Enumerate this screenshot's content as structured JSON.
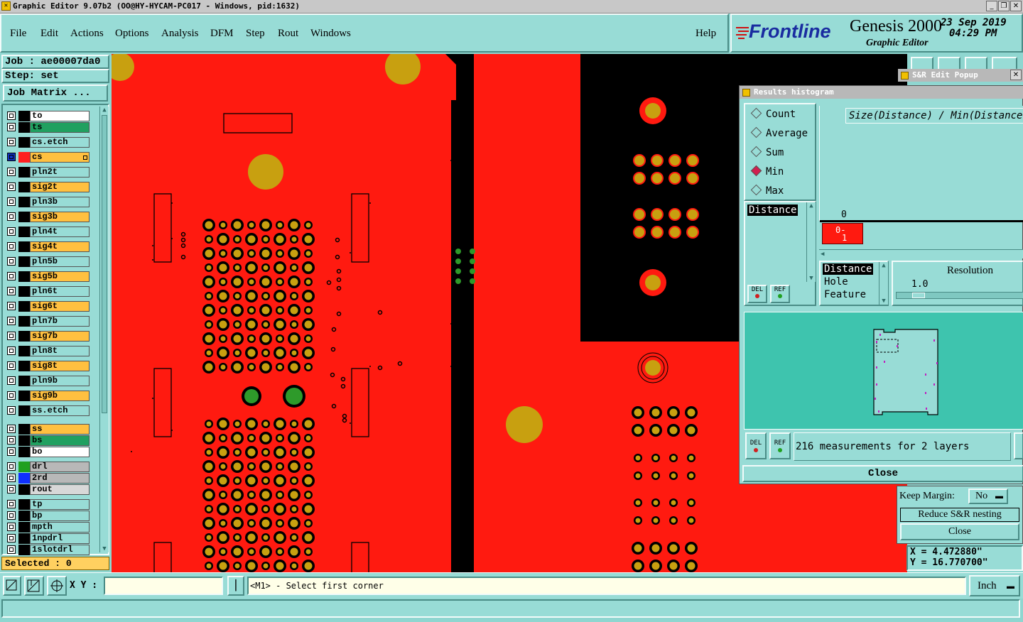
{
  "window": {
    "title": "Graphic Editor 9.07b2  (OO@HY-HYCAM-PC017 - Windows, pid:1632)"
  },
  "menu": {
    "items": [
      "File",
      "Edit",
      "Actions",
      "Options",
      "Analysis",
      "DFM",
      "Step",
      "Rout",
      "Windows"
    ],
    "help": "Help"
  },
  "branding": {
    "logo": "Frontline",
    "product": "Genesis 2000",
    "subtitle": "Graphic Editor",
    "date": "23 Sep 2019",
    "time": "04:29 PM"
  },
  "left": {
    "job": "Job : ae00007da0",
    "step": "Step: set",
    "job_matrix": "Job Matrix ...",
    "selected": "Selected : 0"
  },
  "layers": [
    {
      "name": "to",
      "color": "#ffffff",
      "swatch": "#000000",
      "group": 0
    },
    {
      "name": "ts",
      "color": "#20a060",
      "swatch": "#000000",
      "group": 0
    },
    {
      "name": "cs.etch",
      "color": "#98dcd6",
      "swatch": "#000000",
      "group": 1
    },
    {
      "name": "cs",
      "color": "#ffc040",
      "swatch": "#ff2020",
      "group": 1,
      "active": true
    },
    {
      "name": "pln2t",
      "color": "#98dcd6",
      "swatch": "#000000",
      "group": 1
    },
    {
      "name": "sig2t",
      "color": "#ffc040",
      "swatch": "#000000",
      "group": 1
    },
    {
      "name": "pln3b",
      "color": "#98dcd6",
      "swatch": "#000000",
      "group": 1
    },
    {
      "name": "sig3b",
      "color": "#ffc040",
      "swatch": "#000000",
      "group": 1
    },
    {
      "name": "pln4t",
      "color": "#98dcd6",
      "swatch": "#000000",
      "group": 1
    },
    {
      "name": "sig4t",
      "color": "#ffc040",
      "swatch": "#000000",
      "group": 1
    },
    {
      "name": "pln5b",
      "color": "#98dcd6",
      "swatch": "#000000",
      "group": 1
    },
    {
      "name": "sig5b",
      "color": "#ffc040",
      "swatch": "#000000",
      "group": 1
    },
    {
      "name": "pln6t",
      "color": "#98dcd6",
      "swatch": "#000000",
      "group": 1
    },
    {
      "name": "sig6t",
      "color": "#ffc040",
      "swatch": "#000000",
      "group": 1
    },
    {
      "name": "pln7b",
      "color": "#98dcd6",
      "swatch": "#000000",
      "group": 1
    },
    {
      "name": "sig7b",
      "color": "#ffc040",
      "swatch": "#000000",
      "group": 1
    },
    {
      "name": "pln8t",
      "color": "#98dcd6",
      "swatch": "#000000",
      "group": 1
    },
    {
      "name": "sig8t",
      "color": "#ffc040",
      "swatch": "#000000",
      "group": 1
    },
    {
      "name": "pln9b",
      "color": "#98dcd6",
      "swatch": "#000000",
      "group": 1
    },
    {
      "name": "sig9b",
      "color": "#ffc040",
      "swatch": "#000000",
      "group": 1
    },
    {
      "name": "ss.etch",
      "color": "#98dcd6",
      "swatch": "#000000",
      "group": 1
    },
    {
      "name": "ss",
      "color": "#ffc040",
      "swatch": "#000000",
      "group": 2
    },
    {
      "name": "bs",
      "color": "#20a060",
      "swatch": "#000000",
      "group": 2
    },
    {
      "name": "bo",
      "color": "#ffffff",
      "swatch": "#000000",
      "group": 2
    },
    {
      "name": "drl",
      "color": "#b8b8b8",
      "swatch": "#20a020",
      "group": 3
    },
    {
      "name": "2rd",
      "color": "#b8b8b8",
      "swatch": "#1030ff",
      "group": 3
    },
    {
      "name": "rout",
      "color": "#d8d8d8",
      "swatch": "#000000",
      "group": 3
    },
    {
      "name": "tp",
      "color": "#98dcd6",
      "swatch": "#000000",
      "group": 4
    },
    {
      "name": "bp",
      "color": "#98dcd6",
      "swatch": "#000000",
      "group": 4
    },
    {
      "name": "mpth",
      "color": "#98dcd6",
      "swatch": "#000000",
      "group": 4
    },
    {
      "name": "1npdrl",
      "color": "#98dcd6",
      "swatch": "#000000",
      "group": 4
    },
    {
      "name": "1slotdrl",
      "color": "#98dcd6",
      "swatch": "#000000",
      "group": 4
    }
  ],
  "sr_popup": {
    "title": "S&R Edit Popup",
    "keep_margin_label": "Keep Margin:",
    "keep_margin_value": "No",
    "reduce": "Reduce S&R nesting",
    "close": "Close"
  },
  "histogram": {
    "title": "Results histogram",
    "modes": [
      "Count",
      "Average",
      "Sum",
      "Min",
      "Max"
    ],
    "selected_mode": "Min",
    "header": "Size(Distance) / Min(Distance)",
    "list": [
      "Distance"
    ],
    "axis_zero": "0",
    "bin_label": "0-",
    "bin_label2": "1",
    "attr_list": [
      "Distance",
      "Hole",
      "Feature"
    ],
    "resolution_label": "Resolution",
    "resolution_value": "1.0",
    "del": "DEL",
    "ref": "REF",
    "measurements": "216 measurements for 2 layers",
    "close": "Close"
  },
  "coords": {
    "x": "X = 4.472880\"",
    "y": "Y = 16.770700\""
  },
  "status": {
    "xy_label": "X Y :",
    "xy_value": "",
    "prompt": "<M1> - Select first corner",
    "units": "Inch"
  },
  "colors": {
    "copper": "#ff1a10",
    "pad": "#c8a010",
    "background": "#000000",
    "ui": "#98dcd6"
  }
}
